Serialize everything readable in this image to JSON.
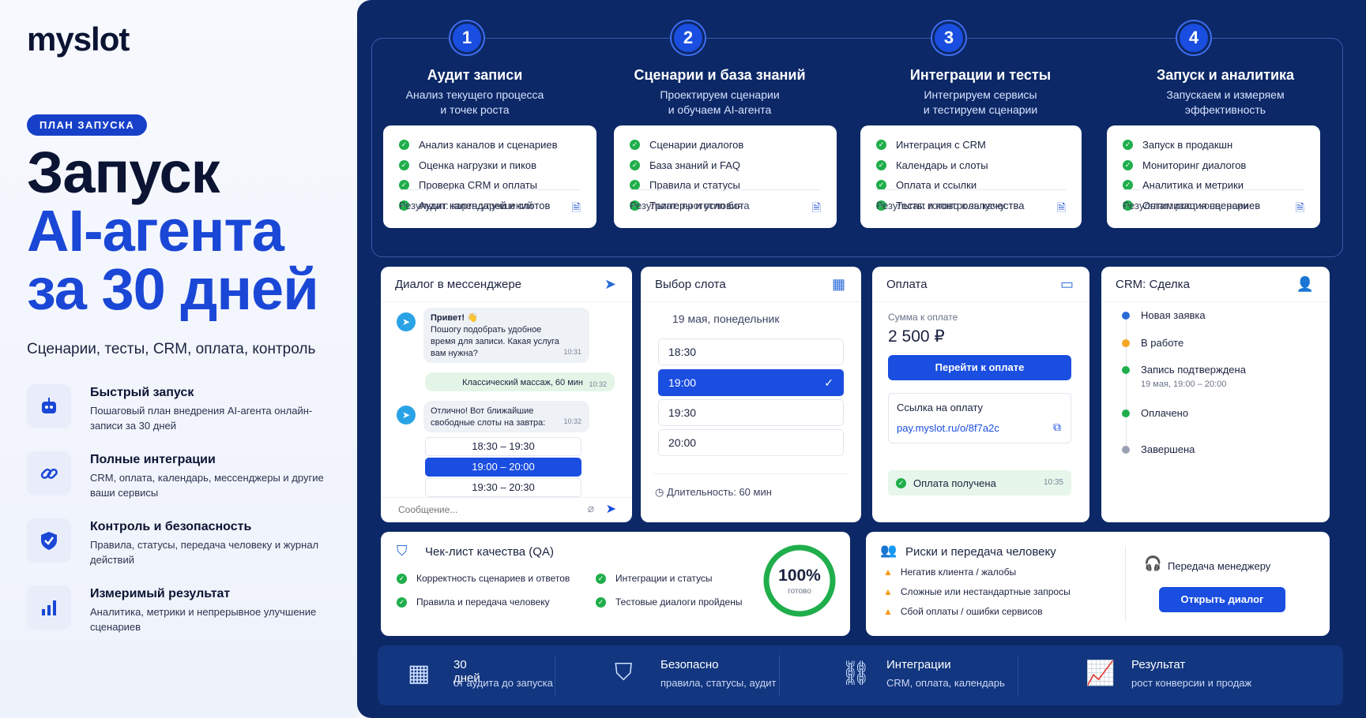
{
  "brand": {
    "logo": "myslot"
  },
  "hero": {
    "badge": "ПЛАН ЗАПУСКА",
    "title_line1": "Запуск",
    "title_line2": "AI-агента",
    "title_line3": "за 30 дней",
    "subtitle": "Сценарии, тесты, CRM, оплата, контроль"
  },
  "features": [
    {
      "title": "Быстрый запуск",
      "desc": "Пошаговый план внедрения AI-агента онлайн-записи за 30 дней",
      "icon": "robot-icon"
    },
    {
      "title": "Полные интеграции",
      "desc": "CRM, оплата, календарь, мессенджеры и другие ваши сервисы",
      "icon": "link-icon"
    },
    {
      "title": "Контроль и безопасность",
      "desc": "Правила, статусы, передача человеку и журнал действий",
      "icon": "shield-icon"
    },
    {
      "title": "Измеримый результат",
      "desc": "Аналитика, метрики и непрерывное улучшение сценариев",
      "icon": "bar-chart-icon"
    }
  ],
  "steps": [
    {
      "num": "1",
      "title": "Аудит записи",
      "desc_1": "Анализ текущего процесса",
      "desc_2": "и точек роста",
      "items": [
        "Анализ каналов и сценариев",
        "Оценка нагрузки и пиков",
        "Проверка CRM и оплаты",
        "Аудит календарей и слотов"
      ],
      "result": "Результат: карта улучшений"
    },
    {
      "num": "2",
      "title": "Сценарии и база знаний",
      "desc_1": "Проектируем сценарии",
      "desc_2": "и обучаем AI-агента",
      "items": [
        "Сценарии диалогов",
        "База знаний и FAQ",
        "Правила и статусы",
        "Триггеры и условия"
      ],
      "result": "Результат: прототип бота"
    },
    {
      "num": "3",
      "title": "Интеграции и тесты",
      "desc_1": "Интегрируем сервисы",
      "desc_2": "и тестируем сценарии",
      "items": [
        "Интеграция с CRM",
        "Календарь и слоты",
        "Оплата и ссылки",
        "Тесты и контроль качества"
      ],
      "result": "Результат: готово к запуску"
    },
    {
      "num": "4",
      "title": "Запуск и аналитика",
      "desc_1": "Запускаем и измеряем",
      "desc_2": "эффективность",
      "items": [
        "Запуск в продакшн",
        "Мониторинг диалогов",
        "Аналитика и метрики",
        "Оптимизация сценариев"
      ],
      "result": "Результат: рост конверсии"
    }
  ],
  "chat": {
    "title": "Диалог в мессенджере",
    "msg1_hello": "Привет! 👋",
    "msg1_body": "Пошогу подобрать удобное время для записи. Какая услуга вам нужна?",
    "msg1_time": "10:31",
    "user_msg": "Классический массаж, 60 мин",
    "user_time": "10:32",
    "msg2_body": "Отлично! Вот ближайшие свободные слоты на завтра:",
    "msg2_time": "10:32",
    "slots": [
      "18:30 – 19:30",
      "19:00 – 20:00",
      "19:30 – 20:30"
    ],
    "input_placeholder": "Сообщение..."
  },
  "slot_picker": {
    "title": "Выбор слота",
    "date": "19 мая, понедельник",
    "slots": [
      "18:30",
      "19:00",
      "19:30",
      "20:00"
    ],
    "duration": "Длительность: 60 мин"
  },
  "payment": {
    "title": "Оплата",
    "amount_label": "Сумма к оплате",
    "amount": "2 500 ₽",
    "pay_button": "Перейти к оплате",
    "link_label": "Ссылка на оплату",
    "link": "pay.myslot.ru/o/8f7a2c",
    "status": "Оплата получена",
    "status_time": "10:35"
  },
  "crm": {
    "title": "CRM: Сделка",
    "stages": [
      {
        "label": "Новая заявка",
        "sub": "",
        "color": "#2a6bd7"
      },
      {
        "label": "В работе",
        "sub": "",
        "color": "#f5a623"
      },
      {
        "label": "Запись подтверждена",
        "sub": "19 мая, 19:00 – 20:00",
        "color": "#1fae4b"
      },
      {
        "label": "Оплачено",
        "sub": "",
        "color": "#1fae4b"
      },
      {
        "label": "Завершена",
        "sub": "",
        "color": "#9aa1b2"
      }
    ]
  },
  "qa": {
    "title": "Чек-лист качества (QA)",
    "items": [
      "Корректность сценариев и ответов",
      "Правила и передача человеку",
      "Интеграции и статусы",
      "Тестовые диалоги пройдены"
    ],
    "progress_label": "100%",
    "progress_sub": "готово",
    "progress_value": 1.0
  },
  "risks": {
    "title": "Риски и передача человеку",
    "items": [
      "Негатив клиента / жалобы",
      "Сложные или нестандартные запросы",
      "Сбой оплаты / ошибки сервисов"
    ],
    "handoff_label": "Передача менеджеру",
    "open_button": "Открыть диалог"
  },
  "bottom": [
    {
      "title": "30 дней",
      "desc": "от аудита до запуска",
      "icon": "calendar-icon"
    },
    {
      "title": "Безопасно",
      "desc": "правила, статусы, аудит",
      "icon": "shield-check-icon"
    },
    {
      "title": "Интеграции",
      "desc": "CRM, оплата, календарь",
      "icon": "link-icon"
    },
    {
      "title": "Результат",
      "desc": "рост конверсии и продаж",
      "icon": "growth-chart-icon"
    }
  ]
}
